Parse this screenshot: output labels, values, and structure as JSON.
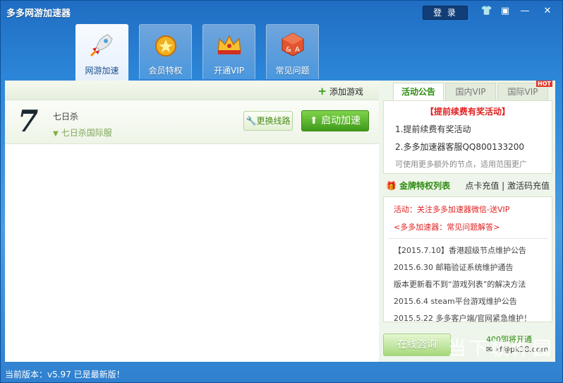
{
  "app": {
    "title": "多多网游加速器"
  },
  "header": {
    "login_label": "登 录"
  },
  "window_controls": {
    "skin": "👕",
    "menu": "▣",
    "minimize": "—",
    "close": "✕"
  },
  "top_tabs": [
    {
      "label": "网游加速",
      "icon": "rocket-icon"
    },
    {
      "label": "会员特权",
      "icon": "medal-icon"
    },
    {
      "label": "开通VIP",
      "icon": "crown-icon"
    },
    {
      "label": "常见问题",
      "icon": "dice-icon"
    }
  ],
  "games": {
    "add_label": "添加游戏",
    "list": [
      {
        "logo_text": "7",
        "name": "七日杀",
        "server": "七日杀国际服",
        "switch_label": "更换线路",
        "start_label": "启动加速"
      }
    ]
  },
  "right_panel": {
    "tabs": [
      "活动公告",
      "国内VIP",
      "国际VIP"
    ],
    "hot_badge": "HOT",
    "notice": {
      "title": "【提前续费有奖活动】",
      "lines": [
        "1.提前续费有奖活动",
        "2.多多加速器客服QQ800133200",
        "可使用更多额外的节点，适用范围更广"
      ]
    },
    "gold_list_label": "金牌特权列表",
    "recharge_links": "点卡充值 | 激活码充值",
    "news": {
      "activity": "活动：关注多多加速器微信-送VIP",
      "faq": "<多多加速器：常见问题解答>",
      "items": [
        "【2015.7.10】香港超级节点维护公告",
        "2015.6.30 邮箱验证系统维护通告",
        "版本更新看不到“游戏列表”的解决方法",
        "2015.6.4 steam平台游戏维护公告",
        "2015.5.22 多多客户端/官网紧急维护！"
      ]
    },
    "consult_label": "在线咨询",
    "phone": "400即将开通",
    "email": "kf@pk38.com"
  },
  "status_bar": {
    "version": "当前版本：v5.97 已是最新版！"
  },
  "watermark": "当下软件园",
  "colors": {
    "accent_green": "#3f9a1a",
    "alert_red": "#e02020",
    "title_blue": "#1f6dc2"
  }
}
